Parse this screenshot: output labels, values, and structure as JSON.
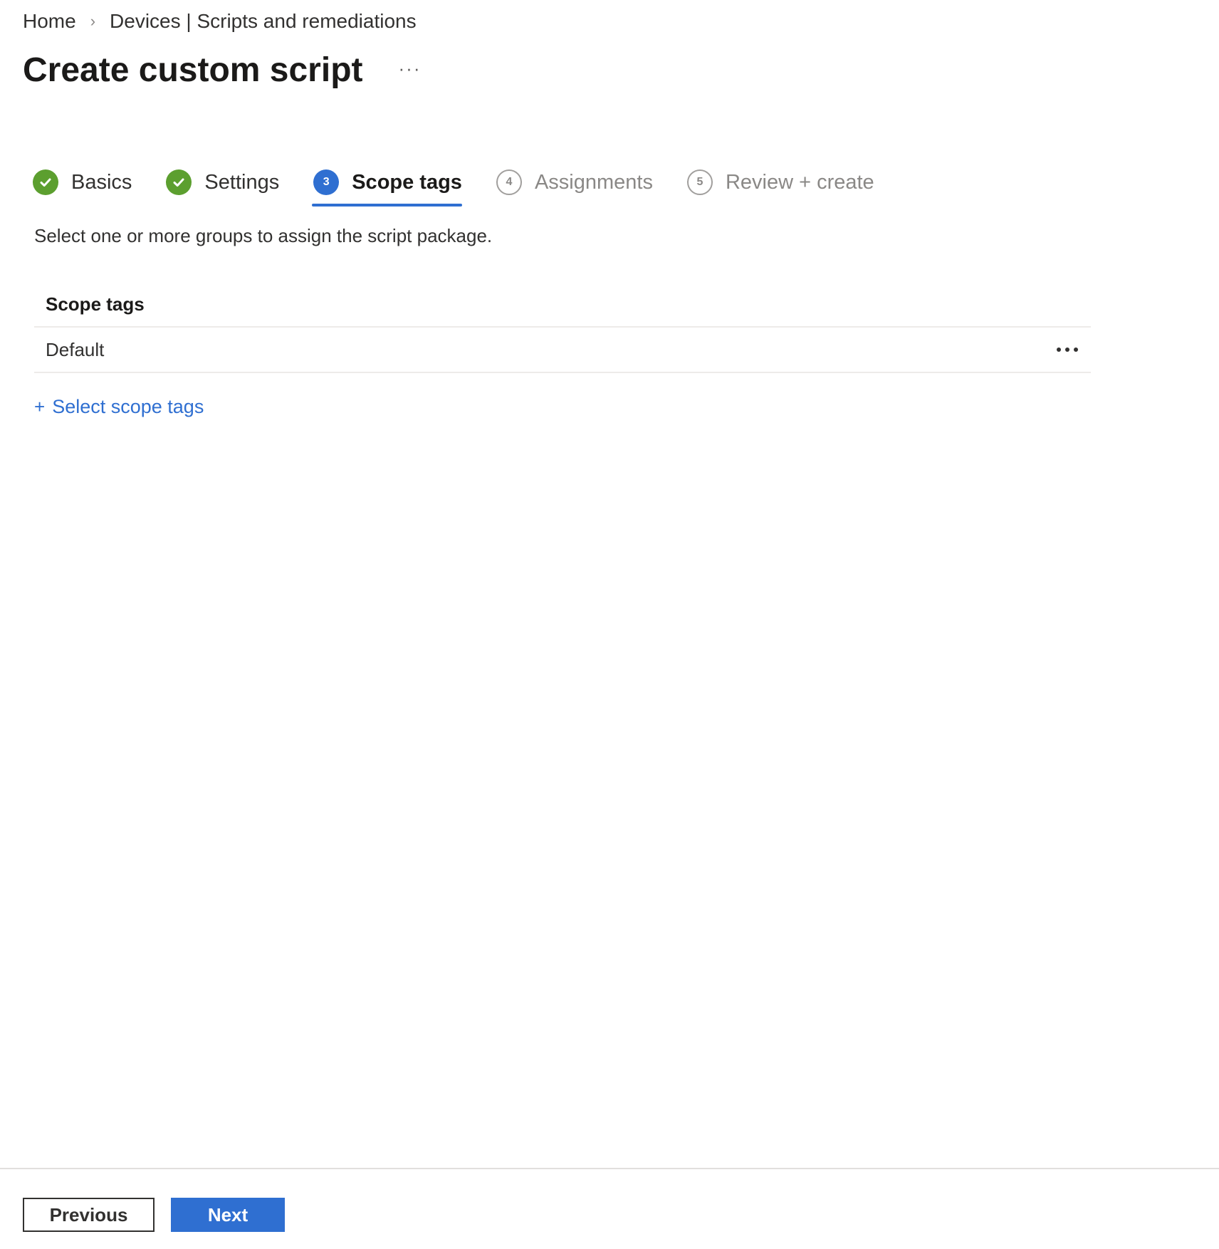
{
  "breadcrumb": {
    "items": [
      "Home",
      "Devices | Scripts and remediations"
    ]
  },
  "header": {
    "title": "Create custom script",
    "more_label": "···"
  },
  "wizard": {
    "steps": [
      {
        "number": "1",
        "label": "Basics",
        "state": "completed"
      },
      {
        "number": "2",
        "label": "Settings",
        "state": "completed"
      },
      {
        "number": "3",
        "label": "Scope tags",
        "state": "current"
      },
      {
        "number": "4",
        "label": "Assignments",
        "state": "pending"
      },
      {
        "number": "5",
        "label": "Review + create",
        "state": "pending"
      }
    ]
  },
  "main": {
    "description": "Select one or more groups to assign the script package.",
    "table": {
      "header": "Scope tags",
      "rows": [
        {
          "name": "Default"
        }
      ]
    },
    "add_link": {
      "plus": "+",
      "label": "Select scope tags"
    }
  },
  "footer": {
    "previous_label": "Previous",
    "next_label": "Next"
  },
  "colors": {
    "accent": "#2f6fd1",
    "success": "#5c9f2f",
    "text": "#323130",
    "muted": "#8a8886"
  }
}
